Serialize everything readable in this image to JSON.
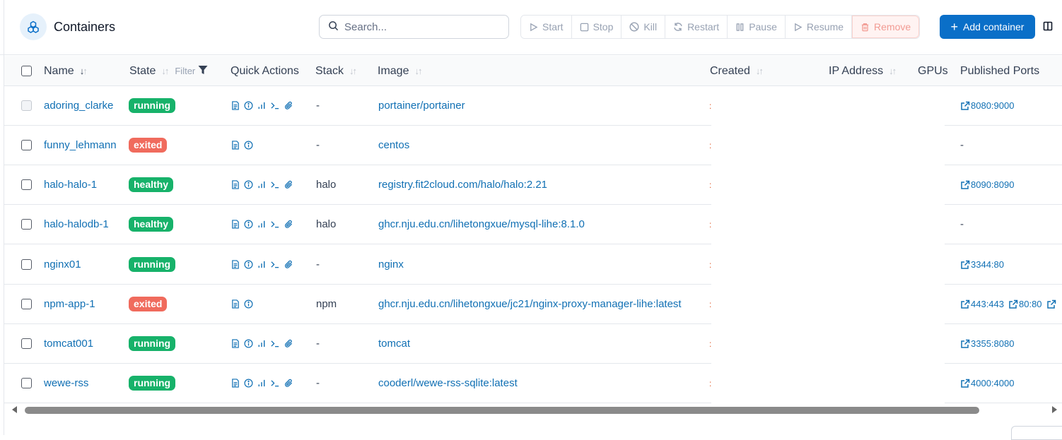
{
  "header": {
    "title": "Containers",
    "search_placeholder": "Search...",
    "actions": [
      "Start",
      "Stop",
      "Kill",
      "Restart",
      "Pause",
      "Resume",
      "Remove"
    ],
    "add_label": "Add container",
    "accent": "#0a6fc8"
  },
  "columns": {
    "name": "Name",
    "state": "State",
    "filter": "Filter",
    "quick_actions": "Quick Actions",
    "stack": "Stack",
    "image": "Image",
    "created": "Created",
    "ip": "IP Address",
    "gpus": "GPUs",
    "ports": "Published Ports"
  },
  "rows": [
    {
      "name": "adoring_clarke",
      "state": "running",
      "stack": "-",
      "image": "portainer/portainer",
      "ports": [
        "8080:9000"
      ],
      "actions": 5,
      "checkbox_disabled": true
    },
    {
      "name": "funny_lehmann",
      "state": "exited",
      "stack": "-",
      "image": "centos",
      "ports": [],
      "no_ports": "-",
      "actions": 2
    },
    {
      "name": "halo-halo-1",
      "state": "healthy",
      "stack": "halo",
      "image": "registry.fit2cloud.com/halo/halo:2.21",
      "ports": [
        "8090:8090"
      ],
      "actions": 5
    },
    {
      "name": "halo-halodb-1",
      "state": "healthy",
      "stack": "halo",
      "image": "ghcr.nju.edu.cn/lihetongxue/mysql-lihe:8.1.0",
      "ports": [],
      "no_ports": "-",
      "actions": 5
    },
    {
      "name": "nginx01",
      "state": "running",
      "stack": "-",
      "image": "nginx",
      "ports": [
        "3344:80"
      ],
      "actions": 5
    },
    {
      "name": "npm-app-1",
      "state": "exited",
      "stack": "npm",
      "image": "ghcr.nju.edu.cn/lihetongxue/jc21/nginx-proxy-manager-lihe:latest",
      "ports": [
        "443:443",
        "80:80",
        ""
      ],
      "actions": 2
    },
    {
      "name": "tomcat001",
      "state": "running",
      "stack": "-",
      "image": "tomcat",
      "ports": [
        "3355:8080"
      ],
      "actions": 5
    },
    {
      "name": "wewe-rss",
      "state": "running",
      "stack": "-",
      "image": "cooderl/wewe-rss-sqlite:latest",
      "ports": [
        "4000:4000"
      ],
      "actions": 5
    }
  ],
  "icons": {
    "title": "cubes-icon",
    "quick_actions": [
      "logs-icon",
      "inspect-icon",
      "stats-icon",
      "console-icon",
      "attach-icon"
    ]
  },
  "status_colors": {
    "running": "#17b26a",
    "healthy": "#17b26a",
    "exited": "#f06b5d"
  }
}
